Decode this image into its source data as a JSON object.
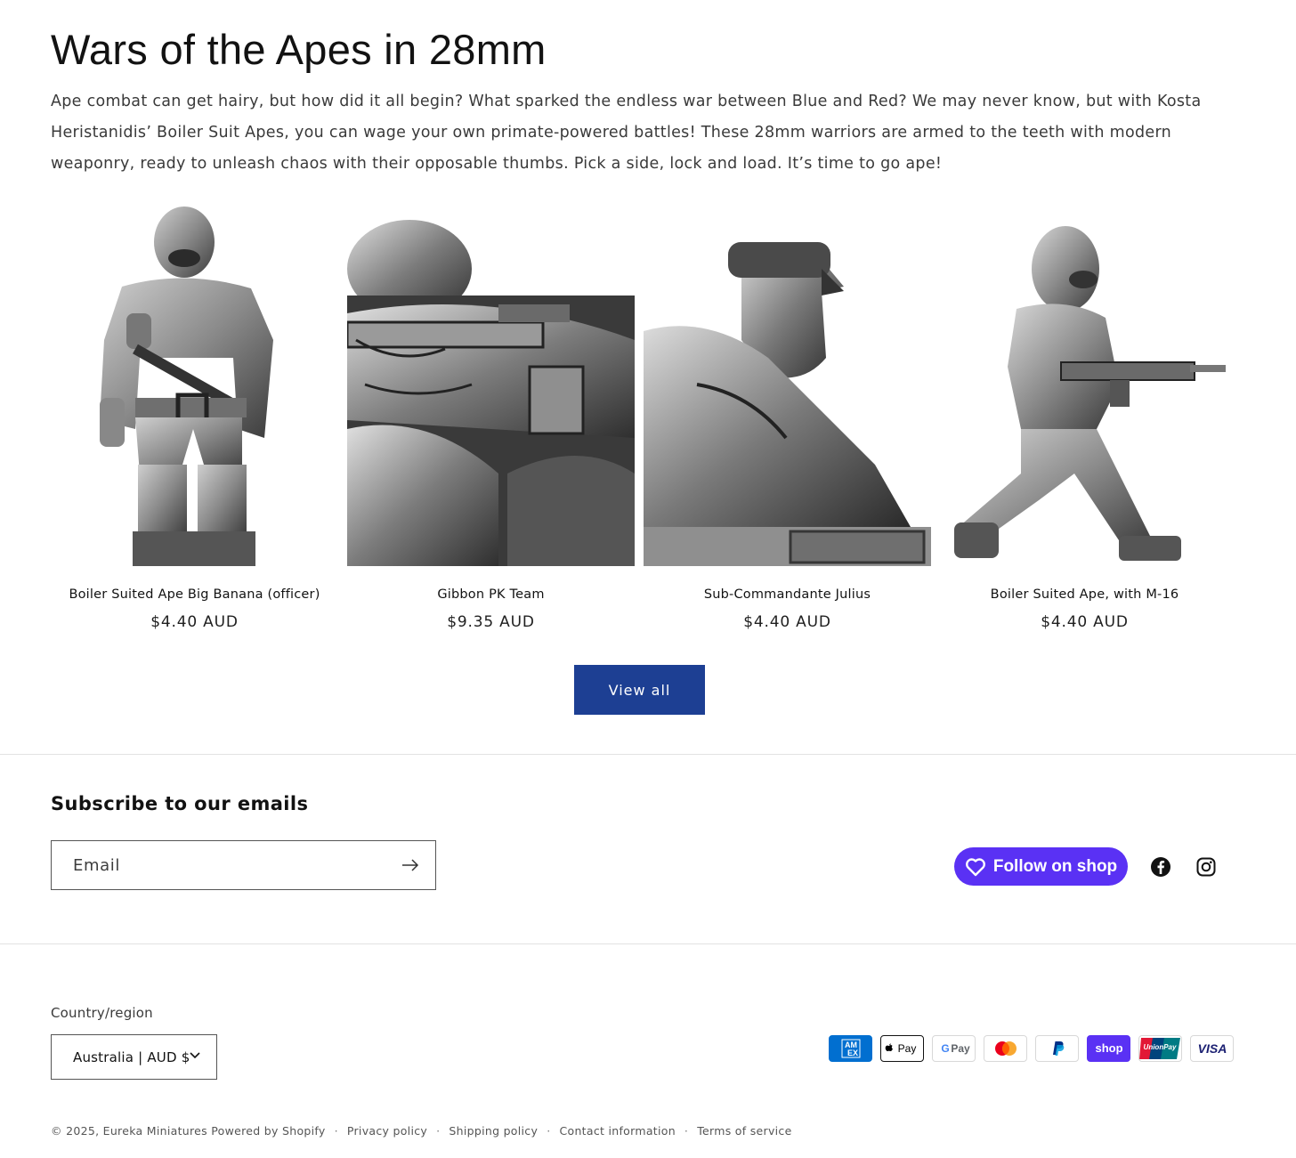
{
  "collection": {
    "title": "Wars of the Apes in 28mm",
    "description": "Ape combat can get hairy, but how did it all begin? What sparked the endless war between Blue and Red? We may never know, but with Kosta Heristanidis’ Boiler Suit Apes, you can wage your own primate-powered battles! These 28mm warriors are armed to the teeth with modern weaponry, ready to unleash chaos with their opposable thumbs. Pick a side, lock and load. It’s time to go ape!",
    "products": [
      {
        "name": "Boiler Suited Ape Big Banana (officer)",
        "price": "$4.40 AUD"
      },
      {
        "name": "Gibbon PK Team",
        "price": "$9.35 AUD"
      },
      {
        "name": "Sub-Commandante Julius",
        "price": "$4.40 AUD"
      },
      {
        "name": "Boiler Suited Ape, with M-16",
        "price": "$4.40 AUD"
      }
    ],
    "view_all_label": "View all"
  },
  "newsletter": {
    "title": "Subscribe to our emails",
    "email_placeholder": "Email"
  },
  "social": {
    "follow_label": "Follow on shop",
    "icons": [
      "facebook-icon",
      "instagram-icon"
    ],
    "brand_color": "#5a31f4"
  },
  "footer": {
    "country_label": "Country/region",
    "country_value": "Australia | AUD $",
    "payment_methods": [
      "American Express",
      "Apple Pay",
      "Google Pay",
      "Mastercard",
      "PayPal",
      "Shop Pay",
      "Union Pay",
      "Visa"
    ],
    "copyright": "© 2025,",
    "store_name": "Eureka Miniatures",
    "powered_by": "Powered by Shopify",
    "links": [
      "Privacy policy",
      "Shipping policy",
      "Contact information",
      "Terms of service"
    ]
  },
  "colors": {
    "button_primary": "#1d3f93",
    "text": "#121212",
    "divider": "#e2e2e2"
  }
}
